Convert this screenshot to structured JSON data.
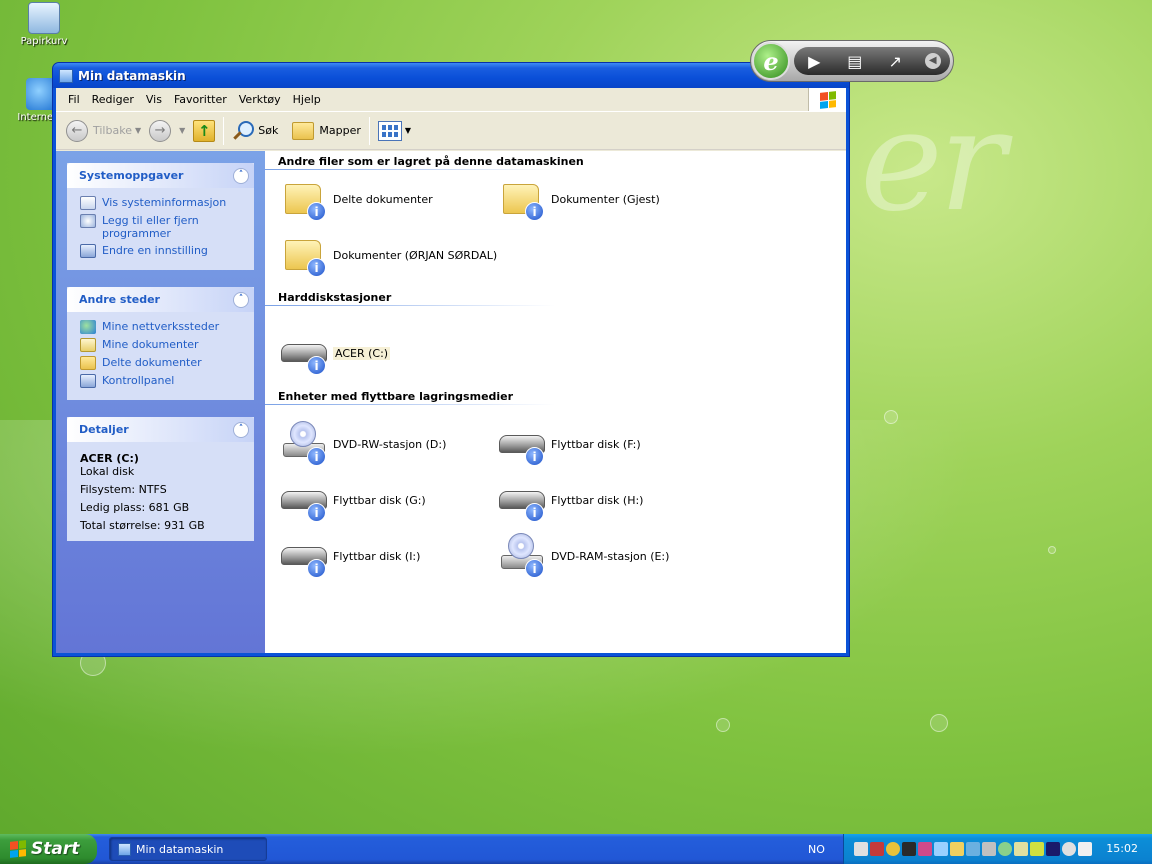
{
  "desktop": {
    "icons": [
      {
        "label": "Papirkurv"
      },
      {
        "label": "Internet E"
      }
    ]
  },
  "window": {
    "title": "Min datamaskin",
    "menu": [
      "Fil",
      "Rediger",
      "Vis",
      "Favoritter",
      "Verktøy",
      "Hjelp"
    ],
    "toolbar": {
      "back_label": "Tilbake",
      "search_label": "Søk",
      "folders_label": "Mapper"
    }
  },
  "taskpane": {
    "system_tasks": {
      "title": "Systemoppgaver",
      "items": [
        {
          "label": "Vis systeminformasjon"
        },
        {
          "label": "Legg til eller fjern programmer"
        },
        {
          "label": "Endre en innstilling"
        }
      ]
    },
    "other_places": {
      "title": "Andre steder",
      "items": [
        {
          "label": "Mine nettverkssteder"
        },
        {
          "label": "Mine dokumenter"
        },
        {
          "label": "Delte dokumenter"
        },
        {
          "label": "Kontrollpanel"
        }
      ]
    },
    "details": {
      "title": "Detaljer",
      "name": "ACER (C:)",
      "type": "Lokal disk",
      "filesystem": "Filsystem: NTFS",
      "free": "Ledig plass: 681 GB",
      "total": "Total størrelse: 931 GB"
    }
  },
  "content": {
    "groups": [
      {
        "title": "Andre filer som er lagret på denne datamaskinen",
        "items": [
          {
            "label": "Delte dokumenter",
            "icon": "folder-icon"
          },
          {
            "label": "Dokumenter (Gjest)",
            "icon": "folder-icon"
          },
          {
            "label": "Dokumenter (ØRJAN SØRDAL)",
            "icon": "folder-icon"
          }
        ]
      },
      {
        "title": "Harddiskstasjoner",
        "items": [
          {
            "label": "ACER (C:)",
            "icon": "hard-drive-icon"
          }
        ]
      },
      {
        "title": "Enheter med flyttbare lagringsmedier",
        "items": [
          {
            "label": "DVD-RW-stasjon (D:)",
            "icon": "dvd-drive-icon"
          },
          {
            "label": "Flyttbar disk (F:)",
            "icon": "removable-disk-icon"
          },
          {
            "label": "Flyttbar disk (G:)",
            "icon": "removable-disk-icon"
          },
          {
            "label": "Flyttbar disk (H:)",
            "icon": "removable-disk-icon"
          },
          {
            "label": "Flyttbar disk (I:)",
            "icon": "removable-disk-icon"
          },
          {
            "label": "DVD-RAM-stasjon (E:)",
            "icon": "dvd-drive-icon"
          }
        ]
      }
    ]
  },
  "floatbar": {
    "logo": "e"
  },
  "taskbar": {
    "start_label": "Start",
    "task_label": "Min datamaskin",
    "language": "NO",
    "clock": "15:02"
  }
}
